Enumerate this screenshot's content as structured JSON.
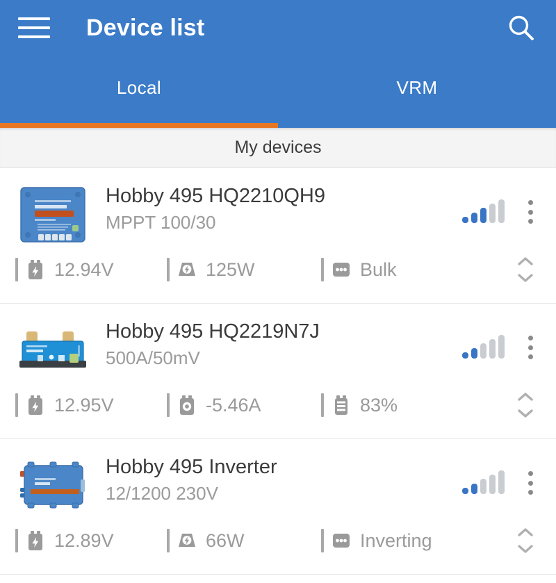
{
  "appbar": {
    "title": "Device list",
    "menu_icon": "hamburger-menu-icon",
    "search_icon": "search-icon",
    "background_color": "#3b7bc8"
  },
  "tabs": {
    "active_index": 0,
    "indicator_color": "#e87722",
    "items": [
      {
        "label": "Local",
        "active": true
      },
      {
        "label": "VRM",
        "active": false
      }
    ]
  },
  "section": {
    "title": "My devices"
  },
  "devices": [
    {
      "name": "Hobby 495 HQ2210QH9",
      "model": "MPPT 100/30",
      "product_image": "bluesolar-mppt-charge-controller",
      "signal_bars_on": 3,
      "signal_bars_total": 5,
      "menu_icon": "kebab-menu-icon",
      "expand_icon": "expand-collapse-chevrons-icon",
      "metrics": [
        {
          "icon": "battery-voltage-icon",
          "value": "12.94V"
        },
        {
          "icon": "solar-power-icon",
          "value": "125W"
        },
        {
          "icon": "charge-state-icon",
          "value": "Bulk"
        }
      ]
    },
    {
      "name": "Hobby 495 HQ2219N7J",
      "model": "500A/50mV",
      "product_image": "smartshunt-battery-monitor",
      "signal_bars_on": 2,
      "signal_bars_total": 5,
      "menu_icon": "kebab-menu-icon",
      "expand_icon": "expand-collapse-chevrons-icon",
      "metrics": [
        {
          "icon": "battery-voltage-icon",
          "value": "12.95V"
        },
        {
          "icon": "battery-current-icon",
          "value": "-5.46A"
        },
        {
          "icon": "state-of-charge-icon",
          "value": "83%"
        }
      ]
    },
    {
      "name": "Hobby 495 Inverter",
      "model": "12/1200 230V",
      "product_image": "phoenix-inverter",
      "signal_bars_on": 2,
      "signal_bars_total": 5,
      "menu_icon": "kebab-menu-icon",
      "expand_icon": "expand-collapse-chevrons-icon",
      "metrics": [
        {
          "icon": "battery-voltage-icon",
          "value": "12.89V"
        },
        {
          "icon": "ac-power-icon",
          "value": "66W"
        },
        {
          "icon": "inverter-state-icon",
          "value": "Inverting"
        }
      ]
    }
  ],
  "colors": {
    "accent_blue": "#3b7bc8",
    "tab_orange": "#e87722",
    "signal_on": "#3a74c4",
    "signal_off": "#c9cdd1",
    "metric_text": "#9a9a9a",
    "device_name_text": "#3b3b3b"
  }
}
